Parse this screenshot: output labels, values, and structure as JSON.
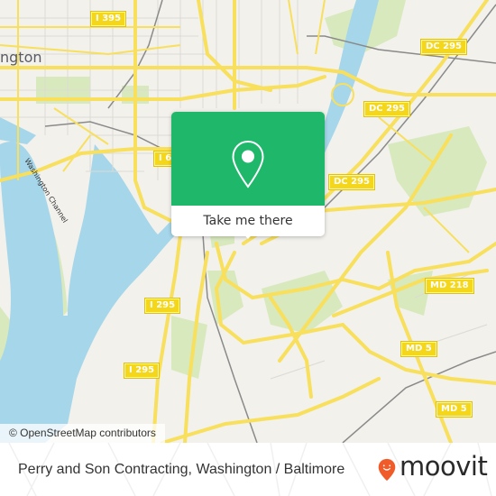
{
  "map": {
    "city_label": "ngton",
    "water_label": "Washington Channel",
    "attribution": "© OpenStreetMap contributors",
    "shields": [
      {
        "id": "i395",
        "label": "I 395"
      },
      {
        "id": "i695",
        "label": "I 6"
      },
      {
        "id": "dc295-a",
        "label": "DC 295"
      },
      {
        "id": "dc295-b",
        "label": "DC 295"
      },
      {
        "id": "dc295-c",
        "label": "DC 295"
      },
      {
        "id": "i295-a",
        "label": "I 295"
      },
      {
        "id": "i295-b",
        "label": "I 295"
      },
      {
        "id": "md218",
        "label": "MD 218"
      },
      {
        "id": "md5-a",
        "label": "MD 5"
      },
      {
        "id": "md5-b",
        "label": "MD 5"
      }
    ],
    "colors": {
      "land": "#f2f1ec",
      "water": "#a6d6ea",
      "park": "#d6e8bc",
      "road": "#f8df5c",
      "rail": "#888888"
    }
  },
  "popup": {
    "icon": "map-pin-icon",
    "button_label": "Take me there",
    "accent": "#1fb86b"
  },
  "footer": {
    "place_title": "Perry and Son Contracting, Washington / Baltimore",
    "brand": "moovit",
    "brand_color": "#f15a29"
  }
}
